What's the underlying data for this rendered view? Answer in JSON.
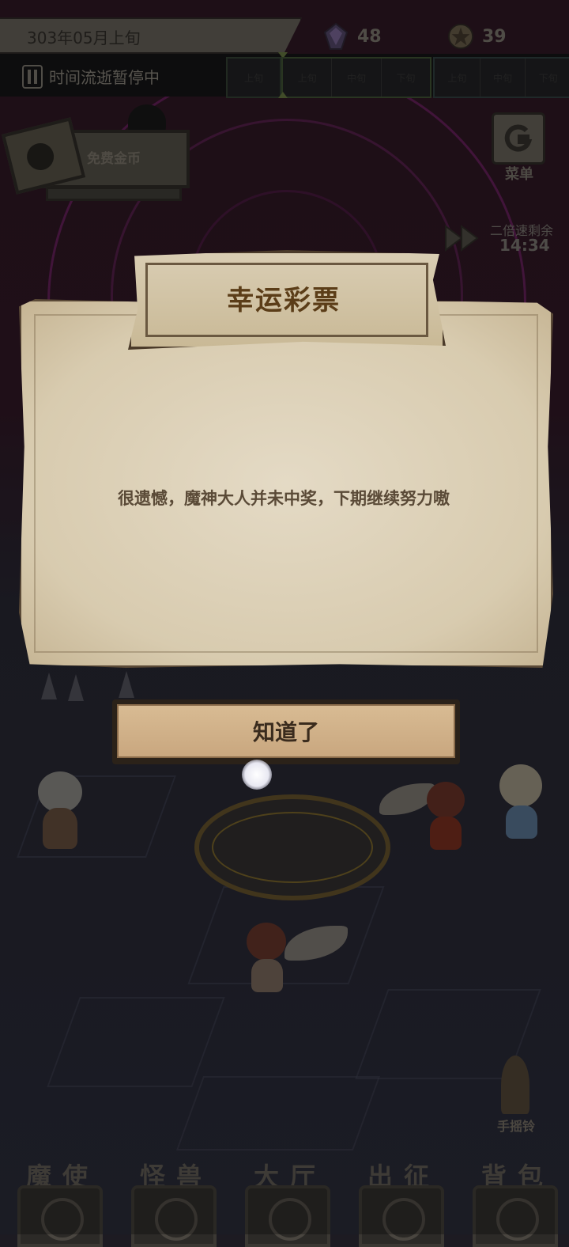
{
  "hud": {
    "date": "303年05月上旬",
    "crystal_count": "48",
    "coin_count": "39",
    "time_status": "时间流逝暂停中",
    "segments": [
      "上旬",
      "上旬",
      "中旬",
      "下旬",
      "上旬",
      "中旬",
      "下旬"
    ]
  },
  "widgets": {
    "free_coin_label": "免费金币",
    "menu_label": "菜单",
    "speed_label": "二倍速剩余",
    "speed_time": "14:34",
    "bell_label": "手摇铃"
  },
  "dialog": {
    "title": "幸运彩票",
    "message": "很遗憾，魔神大人并未中奖，下期继续努力嗷",
    "ok_label": "知道了"
  },
  "bottom_nav": [
    "魔使",
    "怪兽",
    "大厅",
    "出征",
    "背包"
  ],
  "colors": {
    "title_text": "#5b3d18",
    "paper": "#dcd0b6",
    "button": "#d2b38b"
  }
}
